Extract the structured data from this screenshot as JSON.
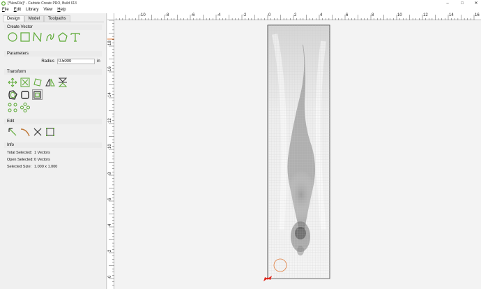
{
  "window": {
    "title": "[*NewFile]* - Carbide Create PRO, Build 613",
    "minimize": "–",
    "maximize": "□",
    "close": "✕"
  },
  "menu": [
    {
      "label": "File",
      "key": "F",
      "rest": "ile"
    },
    {
      "label": "Edit",
      "key": "E",
      "rest": "dit"
    },
    {
      "label": "Library",
      "key": "",
      "rest": "Library"
    },
    {
      "label": "View",
      "key": "",
      "rest": "View"
    },
    {
      "label": "Help",
      "key": "H",
      "rest": "elp"
    }
  ],
  "tabs": [
    "Design",
    "Model",
    "Toolpaths"
  ],
  "active_tab": "Design",
  "sections": {
    "create_vector": "Create Vector",
    "parameters": "Parameters",
    "transform": "Transform",
    "edit": "Edit",
    "info": "Info"
  },
  "parameters": {
    "radius_label": "Radius",
    "radius_value": "0.5000",
    "radius_unit": "in"
  },
  "info": {
    "total_selected_label": "Total Selected:",
    "total_selected_value": "1 Vectors",
    "open_selected_label": "Open Selected:",
    "open_selected_value": "0 Vectors",
    "selected_size_label": "Selected Size:",
    "selected_size_value": "1.000 x 1.000"
  },
  "rulers": {
    "horizontal": [
      "-10",
      "-8",
      "-6",
      "-4",
      "-2",
      "0",
      "2",
      "4",
      "6",
      "8",
      "10",
      "12",
      "14",
      "16"
    ],
    "vertical": [
      "18",
      "16",
      "14",
      "12",
      "10",
      "8",
      "6",
      "4",
      "2",
      "0"
    ]
  },
  "colors": {
    "icon_green": "#5aa832",
    "selection_orange": "#e07b39",
    "origin_red": "#e0261b"
  },
  "icons": {
    "create": [
      "circle-icon",
      "rectangle-icon",
      "polyline-icon",
      "curve-icon",
      "polygon-icon",
      "text-icon"
    ],
    "transform_row1": [
      "move-icon",
      "scale-icon",
      "rotate-icon",
      "mirror-icon",
      "flip-icon"
    ],
    "transform_row2": [
      "offset-icon",
      "round-rect-icon",
      "fillet-icon"
    ],
    "transform_row3": [
      "array-icon",
      "circular-array-icon"
    ],
    "edit": [
      "node-edit-icon",
      "trim-icon",
      "cut-icon",
      "bounding-box-icon"
    ]
  }
}
